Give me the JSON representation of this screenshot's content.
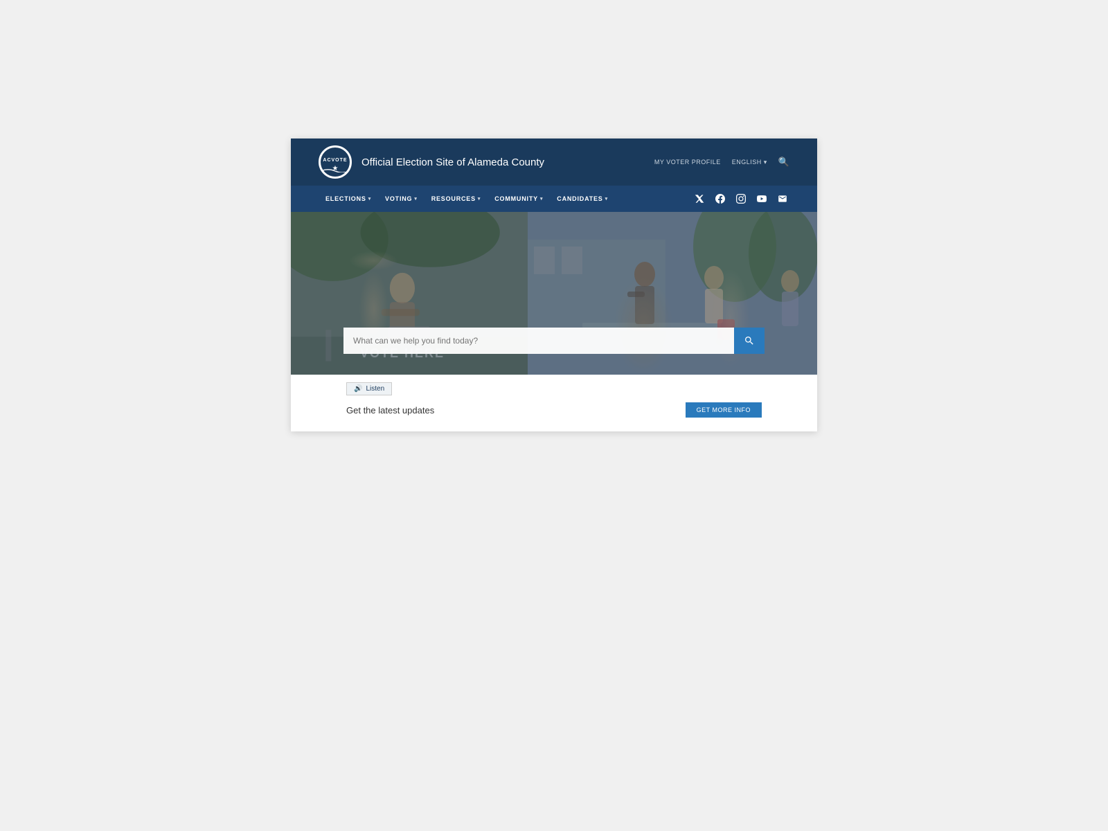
{
  "header": {
    "logo_text": "ACVOTE",
    "site_title": "Official Election Site of Alameda County",
    "voter_profile_label": "MY VOTER PROFILE",
    "language_label": "ENGLISH",
    "language_chevron": "▾"
  },
  "nav": {
    "items": [
      {
        "label": "ELECTIONS",
        "has_dropdown": true
      },
      {
        "label": "VOTING",
        "has_dropdown": true
      },
      {
        "label": "RESOURCES",
        "has_dropdown": true
      },
      {
        "label": "COMMUNITY",
        "has_dropdown": true
      },
      {
        "label": "CANDIDATES",
        "has_dropdown": true
      }
    ],
    "social": {
      "twitter": "𝕏",
      "facebook": "f",
      "instagram": "◎",
      "youtube": "▶",
      "email": "✉"
    }
  },
  "hero": {
    "search_placeholder": "What can we help you find today?",
    "vote_here_text": "VOTE HERE"
  },
  "below_hero": {
    "listen_label": "Listen",
    "updates_text": "Get the latest updates",
    "updates_btn_label": "GET MORE INFO"
  }
}
